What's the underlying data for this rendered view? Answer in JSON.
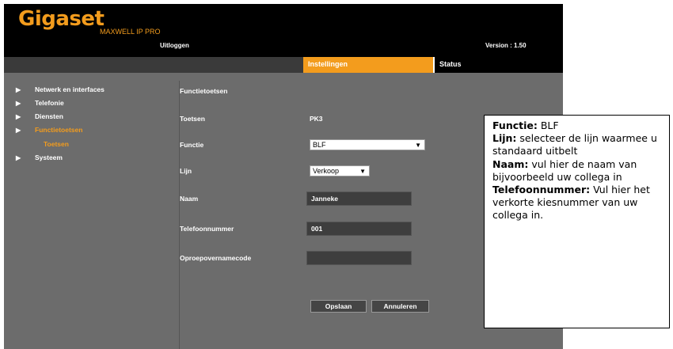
{
  "header": {
    "logo": "Gigaset",
    "product": "MAXWELL IP PRO",
    "logout": "Uitloggen",
    "version": "Version : 1.50"
  },
  "nav": {
    "tabs": [
      {
        "label": "Instellingen",
        "active": true
      },
      {
        "label": "Status",
        "active": false
      }
    ]
  },
  "sidebar": {
    "items": [
      {
        "label": "Netwerk en interfaces",
        "arrow": true
      },
      {
        "label": "Telefonie",
        "arrow": false
      },
      {
        "label": "Diensten",
        "arrow": false
      },
      {
        "label": "Functietoetsen",
        "arrow": true,
        "active": true
      },
      {
        "label": "Systeem",
        "arrow": true
      }
    ],
    "subitem": "Toetsen"
  },
  "form": {
    "heading": "Functietoetsen",
    "toetsen_label": "Toetsen",
    "toetsen_value": "PK3",
    "functie_label": "Functie",
    "functie_value": "BLF",
    "lijn_label": "Lijn",
    "lijn_value": "Verkoop",
    "naam_label": "Naam",
    "naam_value": "Janneke",
    "telefoon_label": "Telefoonnummer",
    "telefoon_value": "001",
    "oproep_label": "Oproepovernamecode",
    "oproep_value": "",
    "save": "Opslaan",
    "cancel": "Annuleren"
  },
  "callout": {
    "functie_key": "Functie:",
    "functie_text": " BLF",
    "lijn_key": "Lijn:",
    "lijn_text": " selecteer de lijn waarmee u standaard uitbelt",
    "naam_key": "Naam:",
    "naam_text": " vul hier de naam van bijvoorbeeld uw collega in",
    "tel_key": "Telefoonnummer:",
    "tel_text": " Vul hier het verkorte kiesnummer van uw collega in."
  },
  "colors": {
    "accent": "#f39c1d",
    "background": "#6c6c6c",
    "header": "#000000"
  }
}
